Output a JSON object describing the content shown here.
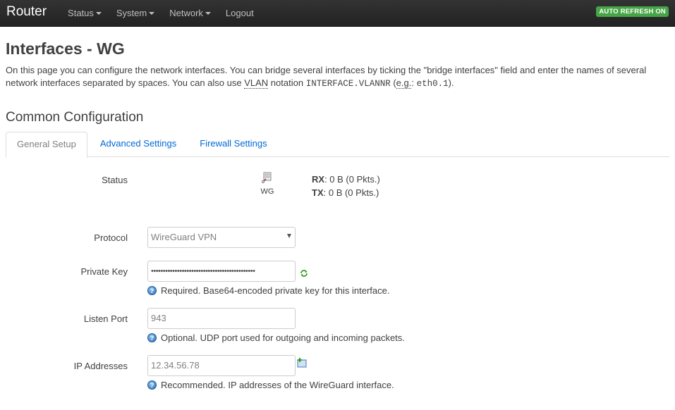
{
  "navbar": {
    "brand": "Router",
    "menu": [
      {
        "label": "Status",
        "has_caret": true
      },
      {
        "label": "System",
        "has_caret": true
      },
      {
        "label": "Network",
        "has_caret": true
      },
      {
        "label": "Logout",
        "has_caret": false
      }
    ],
    "refresh_badge": "AUTO REFRESH ON"
  },
  "page": {
    "title": "Interfaces - WG",
    "description": {
      "part1": "On this page you can configure the network interfaces. You can bridge several interfaces by ticking the \"bridge interfaces\" field and enter the names of several network interfaces separated by spaces. You can also use ",
      "vlan": "VLAN",
      "part2": " notation ",
      "code1": "INTERFACE.VLANNR",
      "part3": " (",
      "eg": "e.g.",
      "part4": ": ",
      "code2": "eth0.1",
      "part5": ")."
    }
  },
  "section": {
    "title": "Common Configuration",
    "tabs": [
      "General Setup",
      "Advanced Settings",
      "Firewall Settings"
    ]
  },
  "status": {
    "label": "Status",
    "iface_name": "WG",
    "rx_label": "RX",
    "rx_value": ": 0 B (0 Pkts.)",
    "tx_label": "TX",
    "tx_value": ": 0 B (0 Pkts.)"
  },
  "protocol": {
    "label": "Protocol",
    "value": "WireGuard VPN"
  },
  "private_key": {
    "label": "Private Key",
    "value": "••••••••••••••••••••••••••••••••••••••••••••",
    "hint": "Required. Base64-encoded private key for this interface."
  },
  "listen_port": {
    "label": "Listen Port",
    "value": "943",
    "hint": "Optional. UDP port used for outgoing and incoming packets."
  },
  "ip_addresses": {
    "label": "IP Addresses",
    "value": "12.34.56.78",
    "hint": "Recommended. IP addresses of the WireGuard interface."
  },
  "colors": {
    "link": "#0069d6",
    "badge": "#46a546",
    "navbar": "#222222"
  }
}
